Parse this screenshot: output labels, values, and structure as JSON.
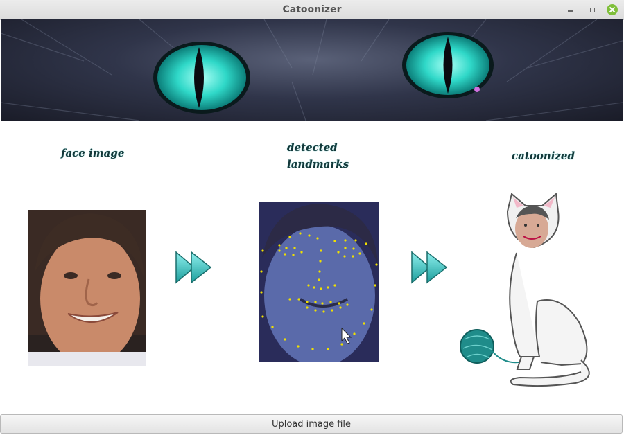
{
  "window": {
    "title": "Catoonizer",
    "controls": [
      "minimize-icon",
      "maximize-icon",
      "close-icon"
    ]
  },
  "colors": {
    "accent": "#2fb3b3",
    "eye_glow": "#38e0d0",
    "landmark_dot": "#f0e000",
    "close_button": "#7fbf3a"
  },
  "headings": {
    "face_image": "face image",
    "landmarks_line1": "detected",
    "landmarks_line2": "landmarks",
    "catoonized": "catoonized"
  },
  "buttons": {
    "upload": "Upload image file"
  }
}
